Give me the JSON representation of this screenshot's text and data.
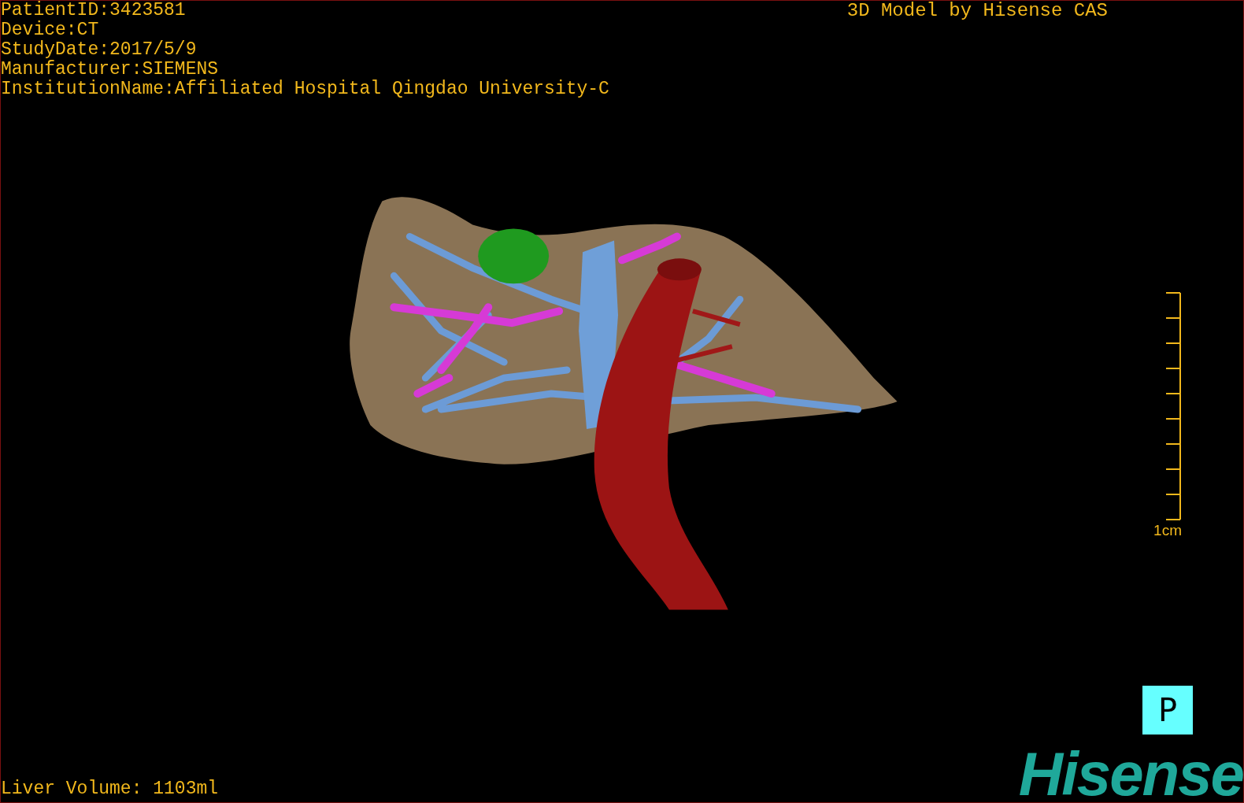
{
  "patient_info": [
    "PatientID:3423581",
    "Device:CT",
    "StudyDate:2017/5/9",
    "Manufacturer:SIEMENS",
    "InstitutionName:Affiliated Hospital Qingdao University-C"
  ],
  "title": "3D Model by Hisense CAS",
  "scale_bar": {
    "label": "1cm"
  },
  "orientation_marker": "P",
  "liver_volume": "Liver Volume: 1103ml",
  "logo": "Hisense"
}
